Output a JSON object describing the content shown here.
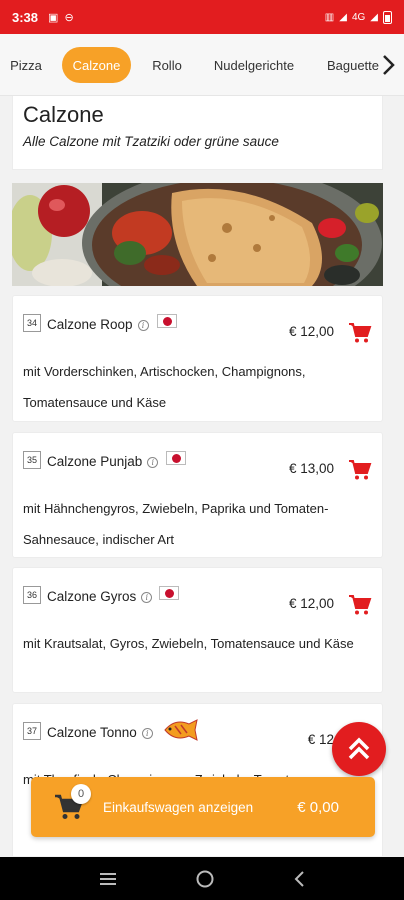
{
  "status_bar": {
    "time": "3:38",
    "network": "4G"
  },
  "tabs": [
    {
      "label": "Pizza",
      "active": false
    },
    {
      "label": "Calzone",
      "active": true
    },
    {
      "label": "Rollo",
      "active": false
    },
    {
      "label": "Nudelgerichte",
      "active": false
    },
    {
      "label": "Baguette",
      "active": false
    }
  ],
  "category": {
    "title": "Calzone",
    "subtitle": "Alle Calzone mit Tzatziki oder grüne sauce"
  },
  "items": [
    {
      "number": "34",
      "name": "Calzone Roop",
      "badge": "flag-icon",
      "price": "€ 12,00",
      "description": "mit Vorderschinken, Artischocken, Champignons, Tomatensauce und Käse"
    },
    {
      "number": "35",
      "name": "Calzone Punjab",
      "badge": "flag-icon",
      "price": "€ 13,00",
      "description": "mit Hähnchengyros, Zwiebeln, Paprika und Tomaten-Sahnesauce, indischer Art"
    },
    {
      "number": "36",
      "name": "Calzone Gyros",
      "badge": "flag-icon",
      "price": "€ 12,00",
      "description": "mit Krautsalat, Gyros, Zwiebeln, Tomatensauce und Käse"
    },
    {
      "number": "37",
      "name": "Calzone Tonno",
      "badge": "fish-icon",
      "price": "€ 12",
      "description": "mit Thunfisch, Champignons, Zwiebeln, Tomaten..."
    }
  ],
  "cart": {
    "count": "0",
    "label": "Einkaufswagen anzeigen",
    "total": "€ 0,00"
  },
  "colors": {
    "brand_red": "#e21d1f",
    "accent_orange": "#f7a127"
  }
}
